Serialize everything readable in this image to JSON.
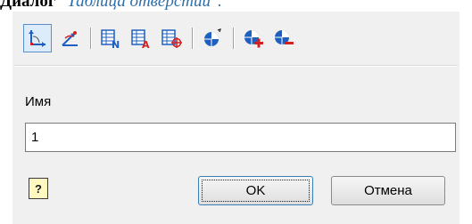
{
  "caption": {
    "lead": "Диалог",
    "title": "\"Таблица отверстий\"."
  },
  "toolbar": {
    "buttons": [
      {
        "icon": "ucs-icon",
        "pressed": true
      },
      {
        "icon": "ucs-rotate-icon"
      },
      {
        "icon": "table-numbering-icon"
      },
      {
        "icon": "table-attribute-icon"
      },
      {
        "icon": "table-add-point-icon"
      },
      {
        "icon": "origin-point-icon"
      },
      {
        "icon": "add-hole-icon"
      },
      {
        "icon": "remove-hole-icon"
      }
    ]
  },
  "form": {
    "name_label": "Имя",
    "name_value": "1"
  },
  "help_button": {
    "label": "?"
  },
  "buttons": {
    "ok": "OK",
    "cancel": "Отмена"
  },
  "colors": {
    "dialog_bg": "#f0f0f0",
    "pressed_bg": "#dcecfb",
    "icon_blue": "#1f5fbf",
    "icon_red": "#d42020"
  }
}
